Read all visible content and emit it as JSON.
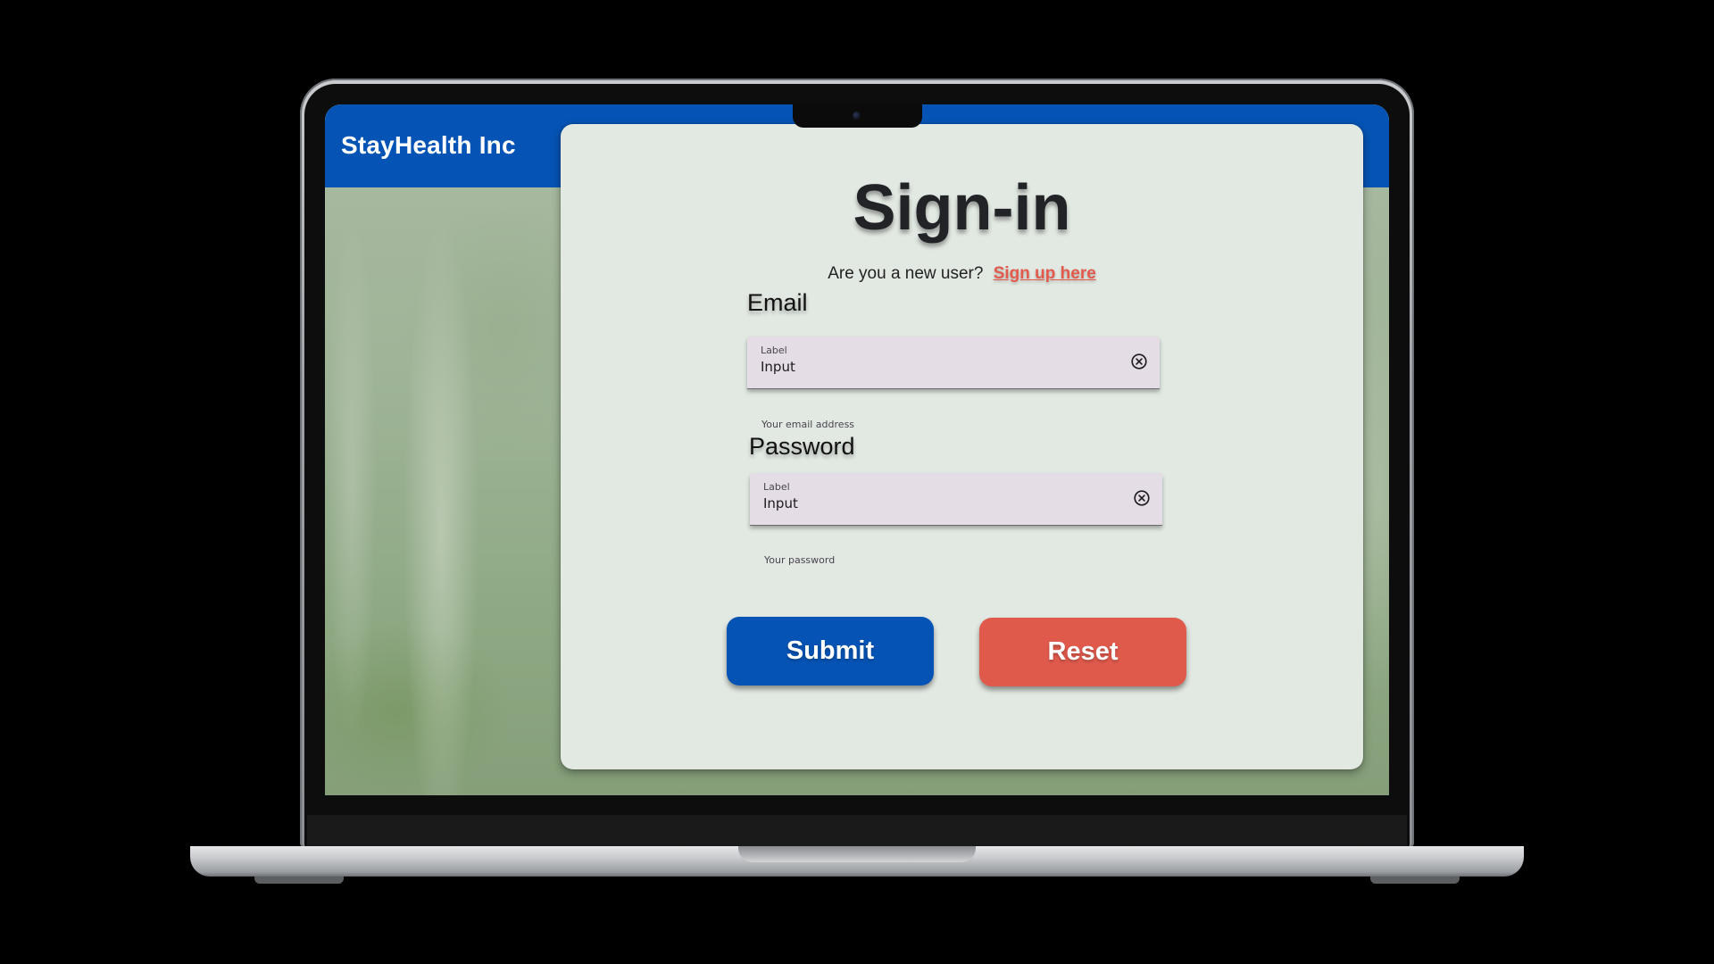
{
  "app": {
    "brand": "StayHealth Inc"
  },
  "signin": {
    "title": "Sign-in",
    "new_user_prompt": "Are you a new user?",
    "signup_link": "Sign up here",
    "email": {
      "heading": "Email",
      "label": "Label",
      "value": "Input",
      "helper": "Your email address",
      "clear_icon": "cancel-circle-icon"
    },
    "password": {
      "heading": "Password",
      "label": "Label",
      "value": "Input",
      "helper": "Your password",
      "clear_icon": "cancel-circle-icon"
    },
    "submit_label": "Submit",
    "reset_label": "Reset"
  },
  "colors": {
    "brand_blue": "#0553b4",
    "accent_red": "#e05a4c",
    "card_bg": "#e2e8e2",
    "field_bg": "#e4dde6"
  }
}
